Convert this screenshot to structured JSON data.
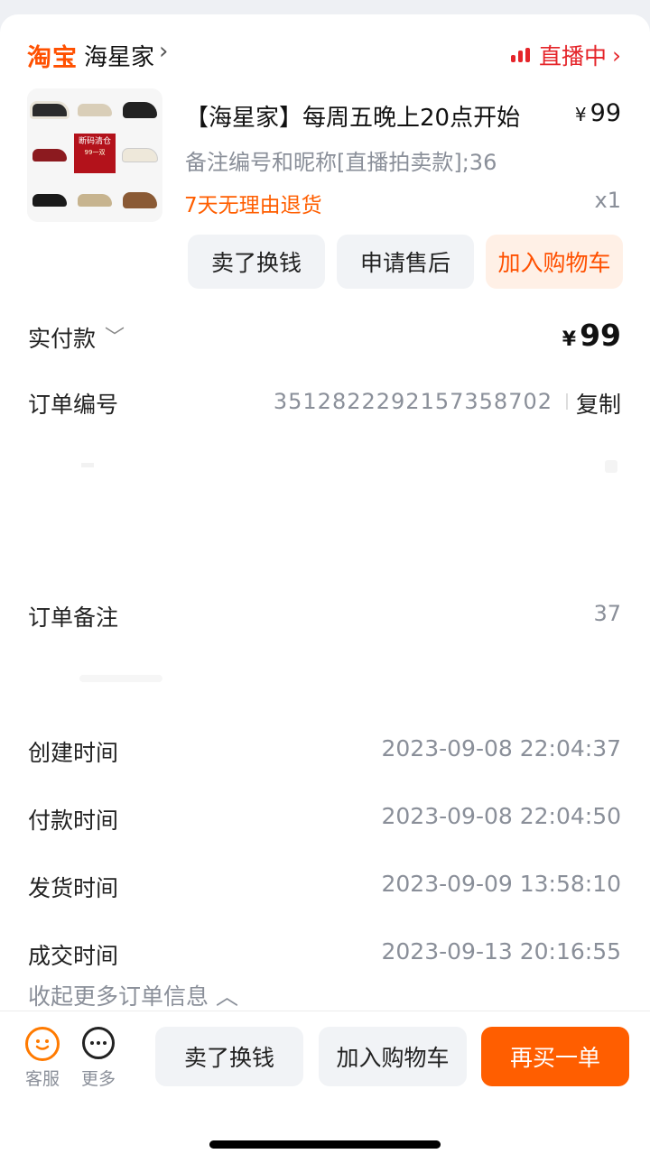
{
  "shop": {
    "platform": "淘宝",
    "name": "海星家",
    "chevron": "›",
    "live_label": "直播中",
    "live_chevron": "›"
  },
  "item": {
    "thumbnail_label": "断码清仓",
    "thumbnail_sub": "99一双",
    "title": "【海星家】每周五晚上20点开始",
    "currency": "¥",
    "price": "99",
    "sku": "备注编号和昵称[直播拍卖款];36",
    "return_policy": "7天无理由退货",
    "quantity": "x1",
    "actions": [
      "卖了换钱",
      "申请售后",
      "加入购物车"
    ]
  },
  "summary": {
    "paid_label": "实付款",
    "paid_currency": "¥",
    "paid_amount": "99",
    "order_no_label": "订单编号",
    "order_no": "3512822292157358702",
    "copy_label": "复制",
    "note_label": "订单备注",
    "note_value": "37",
    "times": [
      {
        "label": "创建时间",
        "value": "2023-09-08 22:04:37"
      },
      {
        "label": "付款时间",
        "value": "2023-09-08 22:04:50"
      },
      {
        "label": "发货时间",
        "value": "2023-09-09 13:58:10"
      },
      {
        "label": "成交时间",
        "value": "2023-09-13 20:16:55"
      }
    ],
    "collapse_label": "收起更多订单信息"
  },
  "bottom_bar": {
    "service_label": "客服",
    "more_label": "更多",
    "buttons": [
      "卖了换钱",
      "加入购物车",
      "再买一单"
    ]
  },
  "colors": {
    "brand": "#ff5000",
    "live": "#e5252a",
    "muted": "#8a8f99"
  }
}
